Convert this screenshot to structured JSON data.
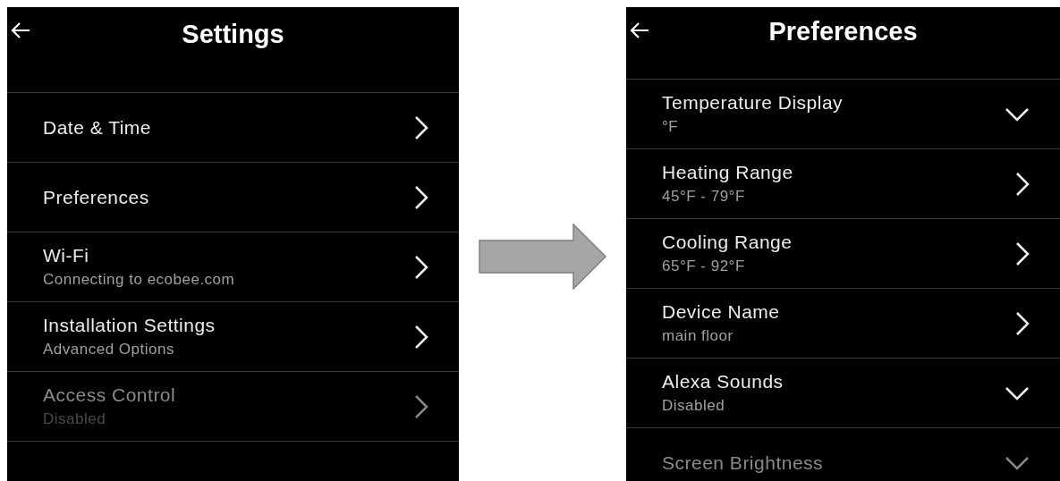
{
  "screens": [
    {
      "title": "Settings",
      "rows": [
        {
          "label": "Date & Time",
          "kind": "chevron-right",
          "dimmed": false
        },
        {
          "label": "Preferences",
          "kind": "chevron-right",
          "dimmed": false
        },
        {
          "label": "Wi-Fi",
          "sublabel": "Connecting to ecobee.com",
          "kind": "chevron-right",
          "dimmed": false
        },
        {
          "label": "Installation Settings",
          "sublabel": "Advanced Options",
          "kind": "chevron-right",
          "dimmed": false
        },
        {
          "label": "Access Control",
          "sublabel": "Disabled",
          "kind": "chevron-right",
          "dimmed": true
        }
      ]
    },
    {
      "title": "Preferences",
      "rows": [
        {
          "label": "Temperature Display",
          "sublabel": "°F",
          "kind": "chevron-down",
          "dimmed": false
        },
        {
          "label": "Heating Range",
          "sublabel": "45°F - 79°F",
          "kind": "chevron-right",
          "dimmed": false
        },
        {
          "label": "Cooling Range",
          "sublabel": "65°F - 92°F",
          "kind": "chevron-right",
          "dimmed": false
        },
        {
          "label": "Device Name",
          "sublabel": "main floor",
          "kind": "chevron-right",
          "dimmed": false
        },
        {
          "label": "Alexa Sounds",
          "sublabel": "Disabled",
          "kind": "chevron-down",
          "dimmed": false
        },
        {
          "label": "Screen Brightness",
          "kind": "chevron-down",
          "dimmed": true
        }
      ]
    }
  ]
}
